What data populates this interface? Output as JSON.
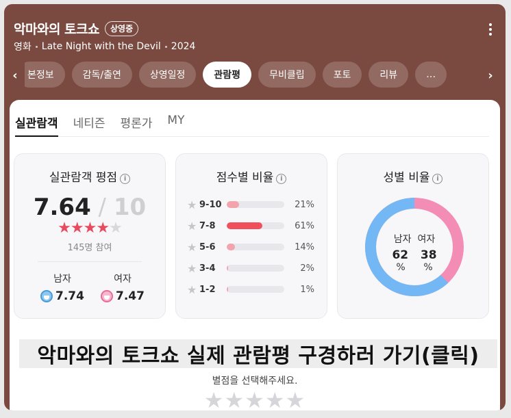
{
  "header": {
    "title": "악마와의 토크쇼",
    "badge": "상영중",
    "category": "영화",
    "original_title": "Late Night with the Devil",
    "year": "2024"
  },
  "tabs": [
    "본정보",
    "감독/출연",
    "상영일정",
    "관람평",
    "무비클립",
    "포토",
    "리뷰",
    "…"
  ],
  "active_tab": "관람평",
  "subtabs": [
    "실관람객",
    "네티즌",
    "평론가",
    "MY"
  ],
  "active_subtab": "실관람객",
  "rating_panel": {
    "title": "실관람객 평점",
    "score": "7.64",
    "max": "10",
    "stars_filled": 4,
    "count_text": "145명 참여",
    "male_label": "남자",
    "male_score": "7.74",
    "female_label": "여자",
    "female_score": "7.47"
  },
  "distribution_panel": {
    "title": "점수별 비율",
    "rows": [
      {
        "label": "9-10",
        "percent": 21,
        "text": "21%"
      },
      {
        "label": "7-8",
        "percent": 61,
        "text": "61%"
      },
      {
        "label": "5-6",
        "percent": 14,
        "text": "14%"
      },
      {
        "label": "3-4",
        "percent": 2,
        "text": "2%"
      },
      {
        "label": "1-2",
        "percent": 1,
        "text": "1%"
      }
    ]
  },
  "gender_panel": {
    "title": "성별 비율",
    "male_label": "남자",
    "female_label": "여자",
    "male_pct": 62,
    "female_pct": 38,
    "unit": "%",
    "male_color": "#74b7f5",
    "female_color": "#f48db5"
  },
  "banner_text": "악마와의 토크쇼 실제 관람평 구경하러 가기(클릭)",
  "rate_prompt": "별점을 선택해주세요.",
  "colors": {
    "header_bg": "#7a4a40",
    "accent_red": "#e84a5f"
  }
}
